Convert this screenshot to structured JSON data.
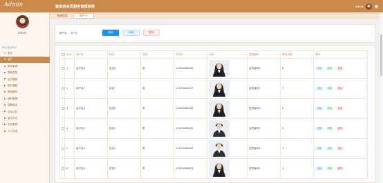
{
  "header": {
    "brand": "Admin",
    "title": "健身房会员服务管理系统",
    "admin": "admin"
  },
  "sidebar": {
    "username": "admin",
    "nav_heading": "Navigation",
    "items": [
      {
        "label": "首页",
        "icon": "home-icon",
        "active": false
      },
      {
        "label": "用户",
        "icon": "user-icon",
        "active": true
      },
      {
        "label": "教练管理",
        "icon": "grid-icon",
        "active": false
      },
      {
        "label": "课程类型",
        "icon": "grid-icon",
        "active": false
      },
      {
        "label": "会员课程",
        "icon": "grid-icon",
        "active": false
      },
      {
        "label": "预约课程",
        "icon": "grid-icon",
        "active": false
      },
      {
        "label": "健身器材",
        "icon": "grid-icon",
        "active": false
      },
      {
        "label": "器材管理",
        "icon": "grid-icon",
        "active": false
      },
      {
        "label": "课程报名",
        "icon": "grid-icon",
        "active": false
      },
      {
        "label": "活动公告",
        "icon": "grid-icon",
        "active": false
      },
      {
        "label": "留言评论",
        "icon": "grid-icon",
        "active": false
      },
      {
        "label": "系统管理",
        "icon": "grid-icon",
        "active": false,
        "expandable": true
      },
      {
        "label": "个人信息",
        "icon": "grid-icon",
        "active": false,
        "expandable": true
      }
    ]
  },
  "tabs": [
    {
      "label": "系统首页"
    },
    {
      "label": "用户 ×"
    }
  ],
  "search": {
    "label": "用户名",
    "placeholder": "用户名",
    "search_btn": "查询",
    "add_btn": "新增",
    "delete_btn": "删除"
  },
  "table": {
    "columns": [
      "序号",
      "用户名",
      "姓名",
      "性别",
      "手机号",
      "头像",
      "会员编号",
      "剩余次数",
      "操作"
    ],
    "actions": {
      "detail": "详情",
      "edit": "修改",
      "delete": "删除"
    },
    "rows": [
      {
        "no": "1",
        "username": "用户名8",
        "name": "姓名8",
        "gender": "男",
        "phone": "13823888888",
        "member_no": "会员编号8",
        "remaining": "8",
        "photo": "female"
      },
      {
        "no": "2",
        "username": "用户名7",
        "name": "姓名7",
        "gender": "男",
        "phone": "13823888887",
        "member_no": "会员编号7",
        "remaining": "7",
        "photo": "female"
      },
      {
        "no": "3",
        "username": "用户名6",
        "name": "姓名6",
        "gender": "男",
        "phone": "13823888886",
        "member_no": "会员编号6",
        "remaining": "6",
        "photo": "female"
      },
      {
        "no": "4",
        "username": "用户名5",
        "name": "姓名5",
        "gender": "男",
        "phone": "13823888885",
        "member_no": "会员编号5",
        "remaining": "5",
        "photo": "male"
      },
      {
        "no": "5",
        "username": "用户名4",
        "name": "姓名4",
        "gender": "男",
        "phone": "13823888884",
        "member_no": "会员编号4",
        "remaining": "4",
        "photo": "male"
      },
      {
        "no": "6",
        "username": "用户名3",
        "name": "姓名3",
        "gender": "男",
        "phone": "13823888883",
        "member_no": "会员编号3",
        "remaining": "3",
        "photo": "female"
      }
    ]
  },
  "colors": {
    "accent": "#c98a4b",
    "primary": "#1890ff",
    "danger": "#ff4d4f",
    "success": "#24b36b"
  }
}
